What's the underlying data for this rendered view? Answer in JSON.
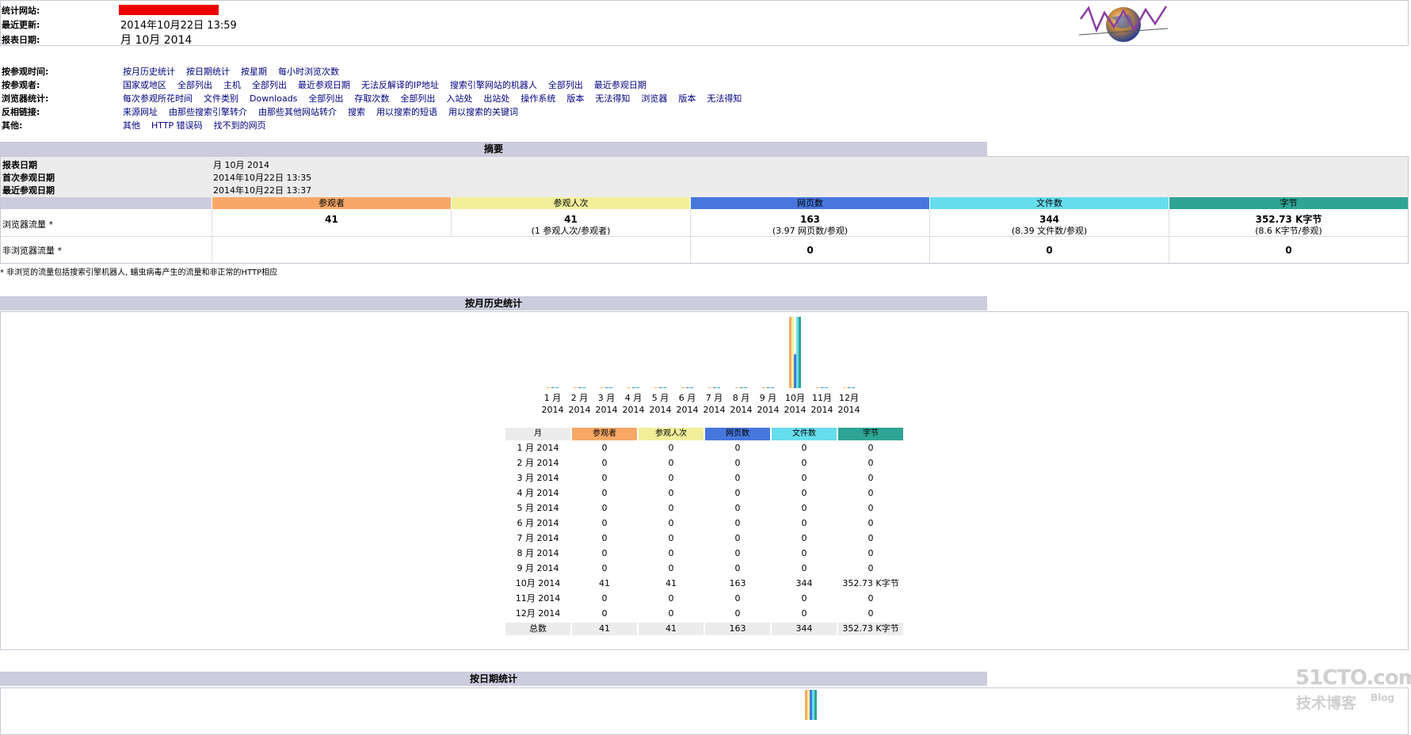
{
  "colors": {
    "visitors": "#f7a867",
    "visits": "#f2ef9b",
    "pages": "#4777dd",
    "hits": "#66dded",
    "bandwidth": "#2ea495",
    "section_bar": "#ccccdd",
    "link": "#000080"
  },
  "header": {
    "site_label": "统计网站:",
    "updated_label": "最近更新:",
    "updated_value": "2014年10月22日  13:59",
    "period_label": "报表日期:",
    "period_value": "月 10月 2014",
    "logo_icon": "globe-logo-icon"
  },
  "nav": {
    "rows": [
      {
        "label": "按参观时间:",
        "links": [
          "按月历史统计",
          "按日期统计",
          "按星期",
          "每小时浏览次数"
        ]
      },
      {
        "label": "按参观者:",
        "links": [
          "国家或地区",
          "全部列出",
          "主机",
          "全部列出",
          "最近参观日期",
          "无法反解译的IP地址",
          "搜索引擎网站的机器人",
          "全部列出",
          "最近参观日期"
        ]
      },
      {
        "label": "浏览器统计:",
        "links": [
          "每次参观所花时间",
          "文件类别",
          "Downloads",
          "全部列出",
          "存取次数",
          "全部列出",
          "入站处",
          "出站处",
          "操作系统",
          "版本",
          "无法得知",
          "浏览器",
          "版本",
          "无法得知"
        ]
      },
      {
        "label": "反相链接:",
        "links": [
          "来源网址",
          "由那些搜索引擎转介",
          "由那些其他网站转介",
          "搜索",
          "用以搜索的短语",
          "用以搜索的关键词"
        ]
      },
      {
        "label": "其他:",
        "links": [
          "其他",
          "HTTP 错误码",
          "找不到的网页"
        ]
      }
    ]
  },
  "summary": {
    "title": "摘要",
    "period_label": "报表日期",
    "period_value": "月 10月 2014",
    "first_label": "首次参观日期",
    "first_value": "2014年10月22日  13:35",
    "last_label": "最近参观日期",
    "last_value": "2014年10月22日  13:37",
    "columns": [
      "参观者",
      "参观人次",
      "网页数",
      "文件数",
      "字节"
    ],
    "viewed": {
      "label": "浏览器流量 *",
      "visitors": "41",
      "visits": "41",
      "visits_sub": "(1 参观人次/参观者)",
      "pages": "163",
      "pages_sub": "(3.97 网页数/参观)",
      "hits": "344",
      "hits_sub": "(8.39 文件数/参观)",
      "bandwidth": "352.73 K字节",
      "bandwidth_sub": "(8.6 K字节/参观)"
    },
    "notviewed": {
      "label": "非浏览器流量 *",
      "pages": "0",
      "hits": "0",
      "bandwidth": "0"
    },
    "footnote": "* 非浏览的流量包括搜索引擎机器人, 蠕虫病毒产生的流量和非正常的HTTP相应"
  },
  "monthly": {
    "title": "按月历史统计",
    "table_headers": [
      "月",
      "参观者",
      "参观人次",
      "网页数",
      "文件数",
      "字节"
    ],
    "rows": [
      [
        "1 月  2014",
        "0",
        "0",
        "0",
        "0",
        "0"
      ],
      [
        "2 月  2014",
        "0",
        "0",
        "0",
        "0",
        "0"
      ],
      [
        "3 月  2014",
        "0",
        "0",
        "0",
        "0",
        "0"
      ],
      [
        "4 月  2014",
        "0",
        "0",
        "0",
        "0",
        "0"
      ],
      [
        "5 月  2014",
        "0",
        "0",
        "0",
        "0",
        "0"
      ],
      [
        "6 月  2014",
        "0",
        "0",
        "0",
        "0",
        "0"
      ],
      [
        "7 月  2014",
        "0",
        "0",
        "0",
        "0",
        "0"
      ],
      [
        "8 月  2014",
        "0",
        "0",
        "0",
        "0",
        "0"
      ],
      [
        "9 月  2014",
        "0",
        "0",
        "0",
        "0",
        "0"
      ],
      [
        "10月  2014",
        "41",
        "41",
        "163",
        "344",
        "352.73 K字节"
      ],
      [
        "11月  2014",
        "0",
        "0",
        "0",
        "0",
        "0"
      ],
      [
        "12月  2014",
        "0",
        "0",
        "0",
        "0",
        "0"
      ]
    ],
    "total": [
      "总数",
      "41",
      "41",
      "163",
      "344",
      "352.73 K字节"
    ]
  },
  "chart_data": {
    "type": "bar",
    "categories": [
      "1 月 2014",
      "2 月 2014",
      "3 月 2014",
      "4 月 2014",
      "5 月 2014",
      "6 月 2014",
      "7 月 2014",
      "8 月 2014",
      "9 月 2014",
      "10月 2014",
      "11月 2014",
      "12月 2014"
    ],
    "tick_line1": [
      "1 月",
      "2 月",
      "3 月",
      "4 月",
      "5 月",
      "6 月",
      "7 月",
      "8 月",
      "9 月",
      "10月",
      "11月",
      "12月"
    ],
    "tick_line2": [
      "2014",
      "2014",
      "2014",
      "2014",
      "2014",
      "2014",
      "2014",
      "2014",
      "2014",
      "2014",
      "2014",
      "2014"
    ],
    "series": [
      {
        "key": "visitors",
        "values": [
          0,
          0,
          0,
          0,
          0,
          0,
          0,
          0,
          0,
          41,
          0,
          0
        ]
      },
      {
        "key": "visits",
        "values": [
          0,
          0,
          0,
          0,
          0,
          0,
          0,
          0,
          0,
          41,
          0,
          0
        ]
      },
      {
        "key": "pages",
        "values": [
          0,
          0,
          0,
          0,
          0,
          0,
          0,
          0,
          0,
          163,
          0,
          0
        ]
      },
      {
        "key": "hits",
        "values": [
          0,
          0,
          0,
          0,
          0,
          0,
          0,
          0,
          0,
          344,
          0,
          0
        ]
      },
      {
        "key": "bandwidth",
        "values": [
          0,
          0,
          0,
          0,
          0,
          0,
          0,
          0,
          0,
          352.73,
          0,
          0
        ]
      }
    ],
    "grid": false,
    "legend": "none"
  },
  "daily": {
    "title": "按日期统计"
  },
  "watermark": {
    "brand": "51CTO.com",
    "tagline": "技术博客",
    "blog": "Blog"
  }
}
